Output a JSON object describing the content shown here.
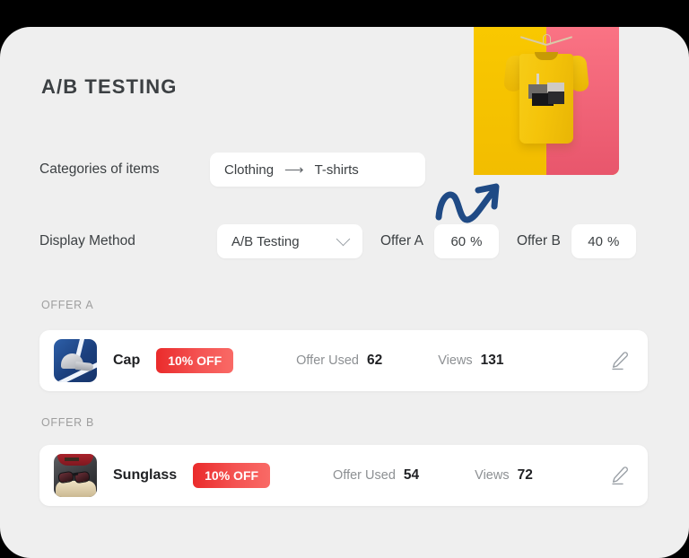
{
  "page": {
    "title": "A/B TESTING"
  },
  "hero": {
    "icon": "tshirt-on-hanger-photo",
    "arrow_icon": "trending-up-arrow-icon",
    "colors": {
      "left_bg": "#f9c800",
      "right_bg": "#fa7384",
      "shirt": "#f5c40a",
      "arrow": "#1f4a85"
    }
  },
  "form": {
    "categories": {
      "label": "Categories of items",
      "from": "Clothing",
      "arrow": "⟶",
      "to": "T-shirts"
    },
    "display_method": {
      "label": "Display Method",
      "value": "A/B Testing",
      "chevron_icon": "chevron-down-icon",
      "options": [
        "A/B Testing"
      ]
    },
    "offer_a": {
      "label": "Offer A",
      "value": "60",
      "unit": "%"
    },
    "offer_b": {
      "label": "Offer B",
      "value": "40",
      "unit": "%"
    }
  },
  "offers": [
    {
      "section_label": "OFFER A",
      "thumbnail_icon": "cap-product-thumbnail",
      "name": "Cap",
      "badge": "10% OFF",
      "badge_color": "#ea2b2b",
      "stats": [
        {
          "label": "Offer Used",
          "value": "62"
        },
        {
          "label": "Views",
          "value": "131"
        }
      ],
      "edit_icon": "pencil-edit-icon"
    },
    {
      "section_label": "OFFER B",
      "thumbnail_icon": "sunglass-product-thumbnail",
      "name": "Sunglass",
      "badge": "10% OFF",
      "badge_color": "#ea2b2b",
      "stats": [
        {
          "label": "Offer Used",
          "value": "54"
        },
        {
          "label": "Views",
          "value": "72"
        }
      ],
      "edit_icon": "pencil-edit-icon"
    }
  ]
}
